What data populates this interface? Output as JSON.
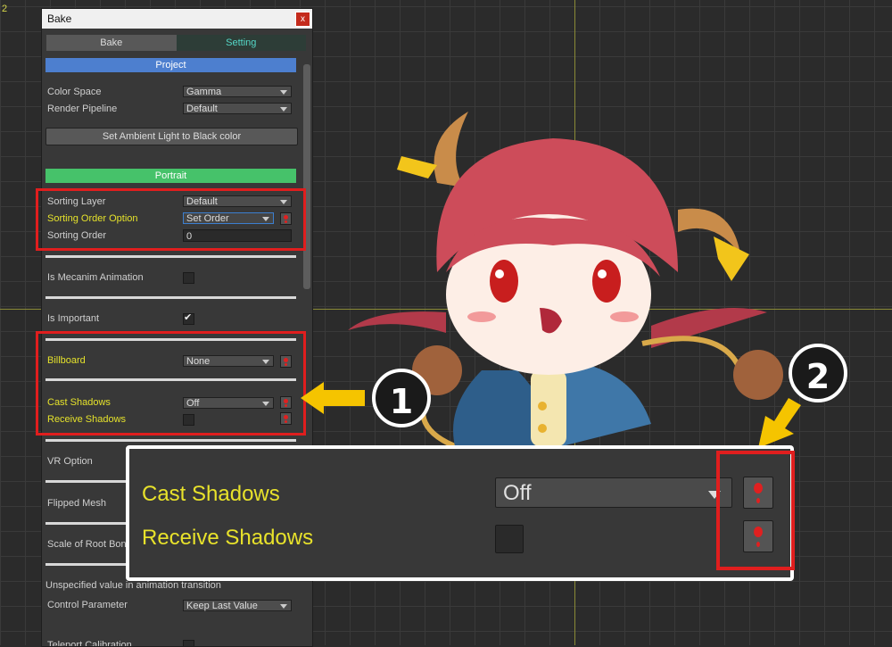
{
  "scene": {
    "corner_label": "2"
  },
  "window": {
    "title": "Bake",
    "close_label": "x",
    "tabs": [
      {
        "label": "Bake"
      },
      {
        "label": "Setting"
      }
    ]
  },
  "project": {
    "header": "Project",
    "color_space": {
      "label": "Color Space",
      "value": "Gamma"
    },
    "render_pipeline": {
      "label": "Render Pipeline",
      "value": "Default"
    },
    "ambient_button": "Set Ambient Light to Black color"
  },
  "portrait": {
    "header": "Portrait",
    "sorting_layer": {
      "label": "Sorting Layer",
      "value": "Default"
    },
    "sorting_order_option": {
      "label": "Sorting Order Option",
      "value": "Set Order"
    },
    "sorting_order": {
      "label": "Sorting Order",
      "value": "0"
    },
    "is_mecanim": {
      "label": "Is Mecanim Animation",
      "checked": false
    },
    "is_important": {
      "label": "Is Important",
      "checked": true
    },
    "billboard": {
      "label": "Billboard",
      "value": "None"
    },
    "cast_shadows": {
      "label": "Cast Shadows",
      "value": "Off"
    },
    "receive_shadows": {
      "label": "Receive Shadows",
      "checked": false
    },
    "vr_option": {
      "label": "VR Option"
    },
    "flipped_mesh": {
      "label": "Flipped Mesh"
    },
    "scale_root": {
      "label": "Scale of Root Bon"
    },
    "unspecified_note": "Unspecified value in animation transition",
    "control_parameter": {
      "label": "Control Parameter",
      "value": "Keep Last Value"
    },
    "teleport": {
      "label": "Teleport Calibration"
    }
  },
  "annotations": {
    "badge1": "1",
    "badge2": "2"
  },
  "zoom": {
    "cast_shadows": {
      "label": "Cast Shadows",
      "value": "Off"
    },
    "receive_shadows": {
      "label": "Receive Shadows"
    }
  },
  "colors": {
    "highlight_red": "#e01e1e",
    "label_yellow": "#e5e22b",
    "arrow_yellow": "#f5c400",
    "setting_tab": "#55d8c8"
  }
}
